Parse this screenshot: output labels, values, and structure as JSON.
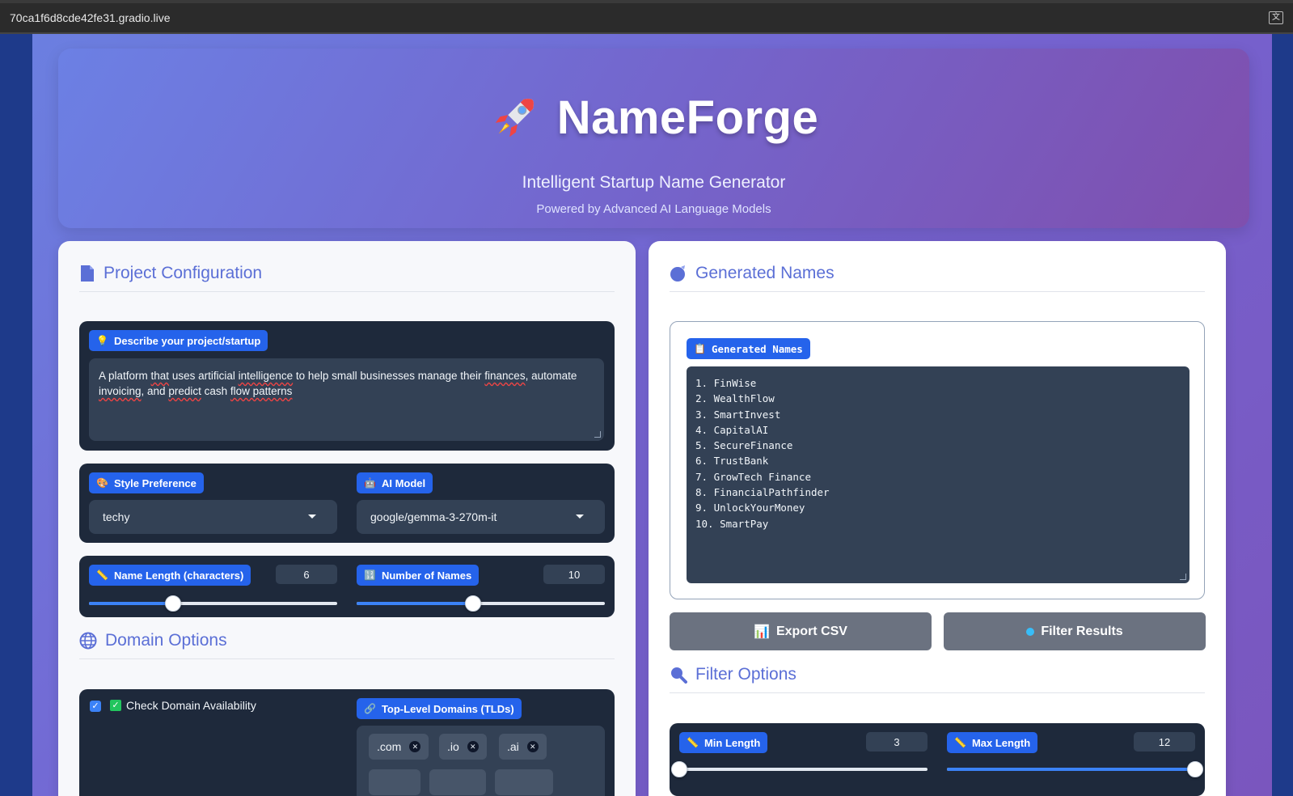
{
  "browser": {
    "url": "70ca1f6d8cde42fe31.gradio.live"
  },
  "hero": {
    "title": "NameForge",
    "subtitle": "Intelligent Startup Name Generator",
    "tagline": "Powered by Advanced AI Language Models"
  },
  "config": {
    "heading": "Project Configuration",
    "description": {
      "label": "Describe your project/startup",
      "value_parts": [
        "A platform ",
        "that",
        " uses artificial ",
        "intelligence",
        " to help small businesses manage their ",
        "finances",
        ", automate ",
        "invoicing",
        ", and ",
        "predict",
        " cash ",
        "flow patterns"
      ]
    },
    "style": {
      "label": "Style Preference",
      "value": "techy"
    },
    "model": {
      "label": "AI Model",
      "value": "google/gemma-3-270m-it"
    },
    "name_length": {
      "label": "Name Length (characters)",
      "value": "6",
      "fraction": 0.34
    },
    "num_names": {
      "label": "Number of Names",
      "value": "10",
      "fraction": 0.47
    }
  },
  "domain": {
    "heading": "Domain Options",
    "check_label": "Check Domain Availability",
    "tlds_label": "Top-Level Domains (TLDs)",
    "tlds": [
      ".com",
      ".io",
      ".ai"
    ]
  },
  "output": {
    "heading": "Generated Names",
    "label": "Generated Names",
    "names": [
      "1. FinWise",
      "2. WealthFlow",
      "3. SmartInvest",
      "4. CapitalAI",
      "5. SecureFinance",
      "6. TrustBank",
      "7. GrowTech Finance",
      "8. FinancialPathfinder",
      "9. UnlockYourMoney",
      "10. SmartPay"
    ],
    "export_label": "Export CSV",
    "filter_label": "Filter Results"
  },
  "filter": {
    "heading": "Filter Options",
    "min": {
      "label": "Min Length",
      "value": "3",
      "fraction": 0.0
    },
    "max": {
      "label": "Max Length",
      "value": "12",
      "fraction": 1.0
    }
  },
  "colors": {
    "accent": "#2563eb",
    "card": "#1e293b",
    "heading": "#5b6fd6"
  }
}
